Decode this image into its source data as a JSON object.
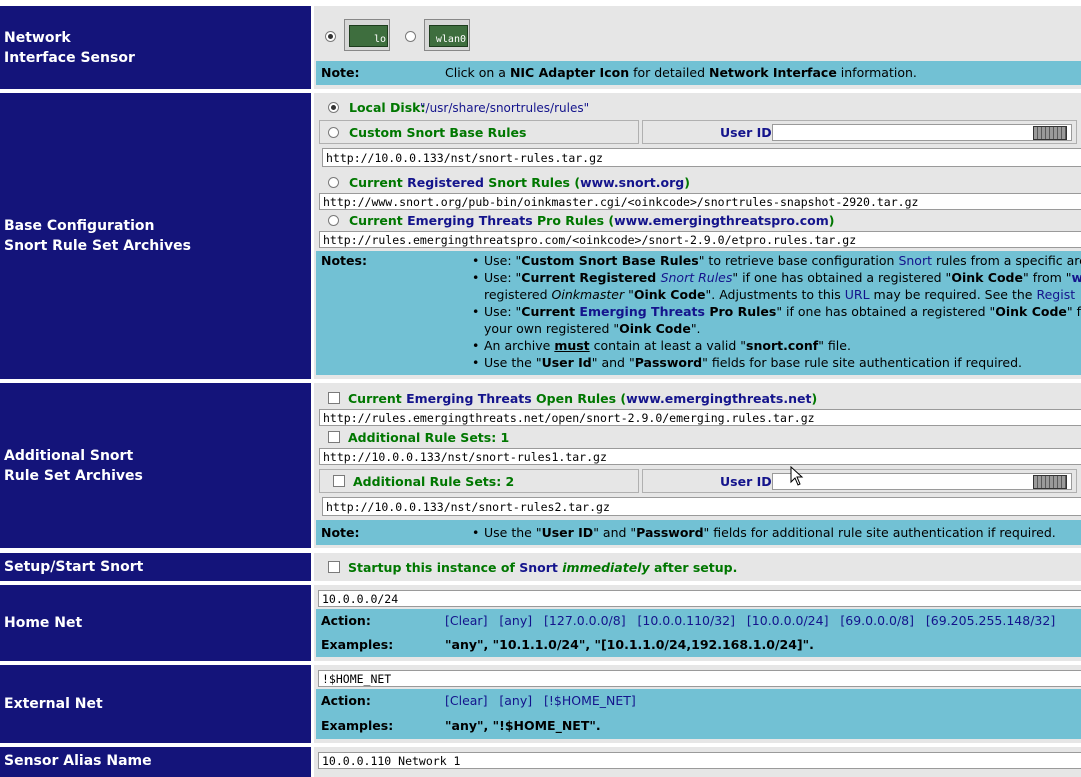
{
  "labels": {
    "nic_line1": "Network",
    "nic_line2": "Interface Sensor",
    "base_line1": "Base Configuration",
    "base_line2": "Snort Rule Set Archives",
    "add_line1": "Additional Snort",
    "add_line2": "Rule Set Archives",
    "setup": "Setup/Start Snort",
    "home_net": "Home Net",
    "external_net": "External Net",
    "sensor_alias": "Sensor Alias Name"
  },
  "nic": {
    "adapters": [
      {
        "label": "lo",
        "selected": true
      },
      {
        "label": "wlan0",
        "selected": false
      }
    ],
    "note_label": "Note:",
    "note_pre": "Click on a ",
    "note_b1": "NIC Adapter Icon",
    "note_mid": " for detailed ",
    "note_b2": "Network Interface",
    "note_post": " information."
  },
  "base": {
    "local_disk_label": "Local Disk:",
    "local_disk_path": " \"/usr/share/snortrules/rules\"",
    "custom_label": "Custom Snort Base Rules",
    "user_id_label": "User ID:",
    "custom_url": "http://10.0.0.133/nst/snort-rules.tar.gz",
    "registered_pre": "Current ",
    "registered_blue": "Registered",
    "registered_post": " Snort Rules",
    "registered_site": "www.snort.org",
    "registered_url": "http://www.snort.org/pub-bin/oinkmaster.cgi/<oinkcode>/snortrules-snapshot-2920.tar.gz",
    "et_pro_pre": "Current ",
    "et_pro_blue": "Emerging Threats",
    "et_pro_post": " Pro Rules",
    "et_pro_site": "www.emergingthreatspro.com",
    "et_pro_url": "http://rules.emergingthreatspro.com/<oinkcode>/snort-2.9.0/etpro.rules.tar.gz",
    "notes_label": "Notes:",
    "note1_a": "Use: \"",
    "note1_b": "Custom Snort Base Rules",
    "note1_c": "\" to retrieve base configuration ",
    "note1_d": "Snort",
    "note1_e": " rules from a specific arch",
    "note2_a": "Use: \"",
    "note2_b": "Current Registered ",
    "note2_c": "Snort Rules",
    "note2_d": "\" if one has obtained a registered \"",
    "note2_e": "Oink Code",
    "note2_f": "\" from \"",
    "note2_g": "ww",
    "note2_h": "registered ",
    "note2_i": "Oinkmaster",
    "note2_j": " \"",
    "note2_k": "Oink Code",
    "note2_l": "\". Adjustments to this ",
    "note2_m": "URL",
    "note2_n": " may be required. See the ",
    "note2_o": "Regist",
    "note3_a": "Use: \"",
    "note3_b": "Current ",
    "note3_c": "Emerging Threats",
    "note3_d": " Pro Rules",
    "note3_e": "\" if one has obtained a registered \"",
    "note3_f": "Oink Code",
    "note3_g": "\" from",
    "note3_h": "your own registered \"",
    "note3_i": "Oink Code",
    "note3_j": "\".",
    "note4_a": "An archive ",
    "note4_b": "must",
    "note4_c": " contain at least a valid \"",
    "note4_d": "snort.conf",
    "note4_e": "\" file.",
    "note5_a": "Use the \"",
    "note5_b": "User Id",
    "note5_c": "\" and \"",
    "note5_d": "Password",
    "note5_e": "\" fields for base rule site authentication if required."
  },
  "additional": {
    "et_open_pre": "Current ",
    "et_open_blue": "Emerging Threats",
    "et_open_post": " Open Rules",
    "et_open_site": "www.emergingthreats.net",
    "et_open_url": "http://rules.emergingthreats.net/open/snort-2.9.0/emerging.rules.tar.gz",
    "set1_label": "Additional Rule Sets: 1",
    "set1_url": "http://10.0.0.133/nst/snort-rules1.tar.gz",
    "set2_label": "Additional Rule Sets: 2",
    "user_id_label": "User ID:",
    "set2_url": "http://10.0.0.133/nst/snort-rules2.tar.gz",
    "note_label": "Note:",
    "note_a": "Use the \"",
    "note_b": "User ID",
    "note_c": "\" and \"",
    "note_d": "Password",
    "note_e": "\" fields for additional rule site authentication if required."
  },
  "setup": {
    "a": "Startup this instance of ",
    "b": "Snort",
    "c": " ",
    "d": "immediately",
    "e": " after setup."
  },
  "home_net": {
    "value": "10.0.0.0/24",
    "action_label": "Action:",
    "actions": [
      "[Clear]",
      "[any]",
      "[127.0.0.0/8]",
      "[10.0.0.110/32]",
      "[10.0.0.0/24]",
      "[69.0.0.0/8]",
      "[69.205.255.148/32]"
    ],
    "examples_label": "Examples:",
    "ex_a": "\"any\", \"",
    "ex_b": "10.1.1.0/24",
    "ex_c": "\", \"",
    "ex_d": "[10.1.1.0/24,192.168.1.0/24]",
    "ex_e": "\"."
  },
  "external_net": {
    "value": "!$HOME_NET",
    "action_label": "Action:",
    "actions": [
      "[Clear]",
      "[any]",
      "[!$HOME_NET]"
    ],
    "examples_label": "Examples:",
    "ex_a": "\"any\", \"",
    "ex_b": "!$HOME_NET",
    "ex_c": "\"."
  },
  "sensor_alias": {
    "value": "10.0.0.110 Network 1"
  },
  "icons": [
    "nic-lo-icon",
    "nic-wlan0-icon",
    "keyboard-icon",
    "mouse-cursor-icon"
  ],
  "colors": {
    "label_bg": "#14147a",
    "content_bg": "#e6e6e6",
    "note_bg": "#72c1d4",
    "green": "#007700",
    "blue": "#14148c"
  }
}
